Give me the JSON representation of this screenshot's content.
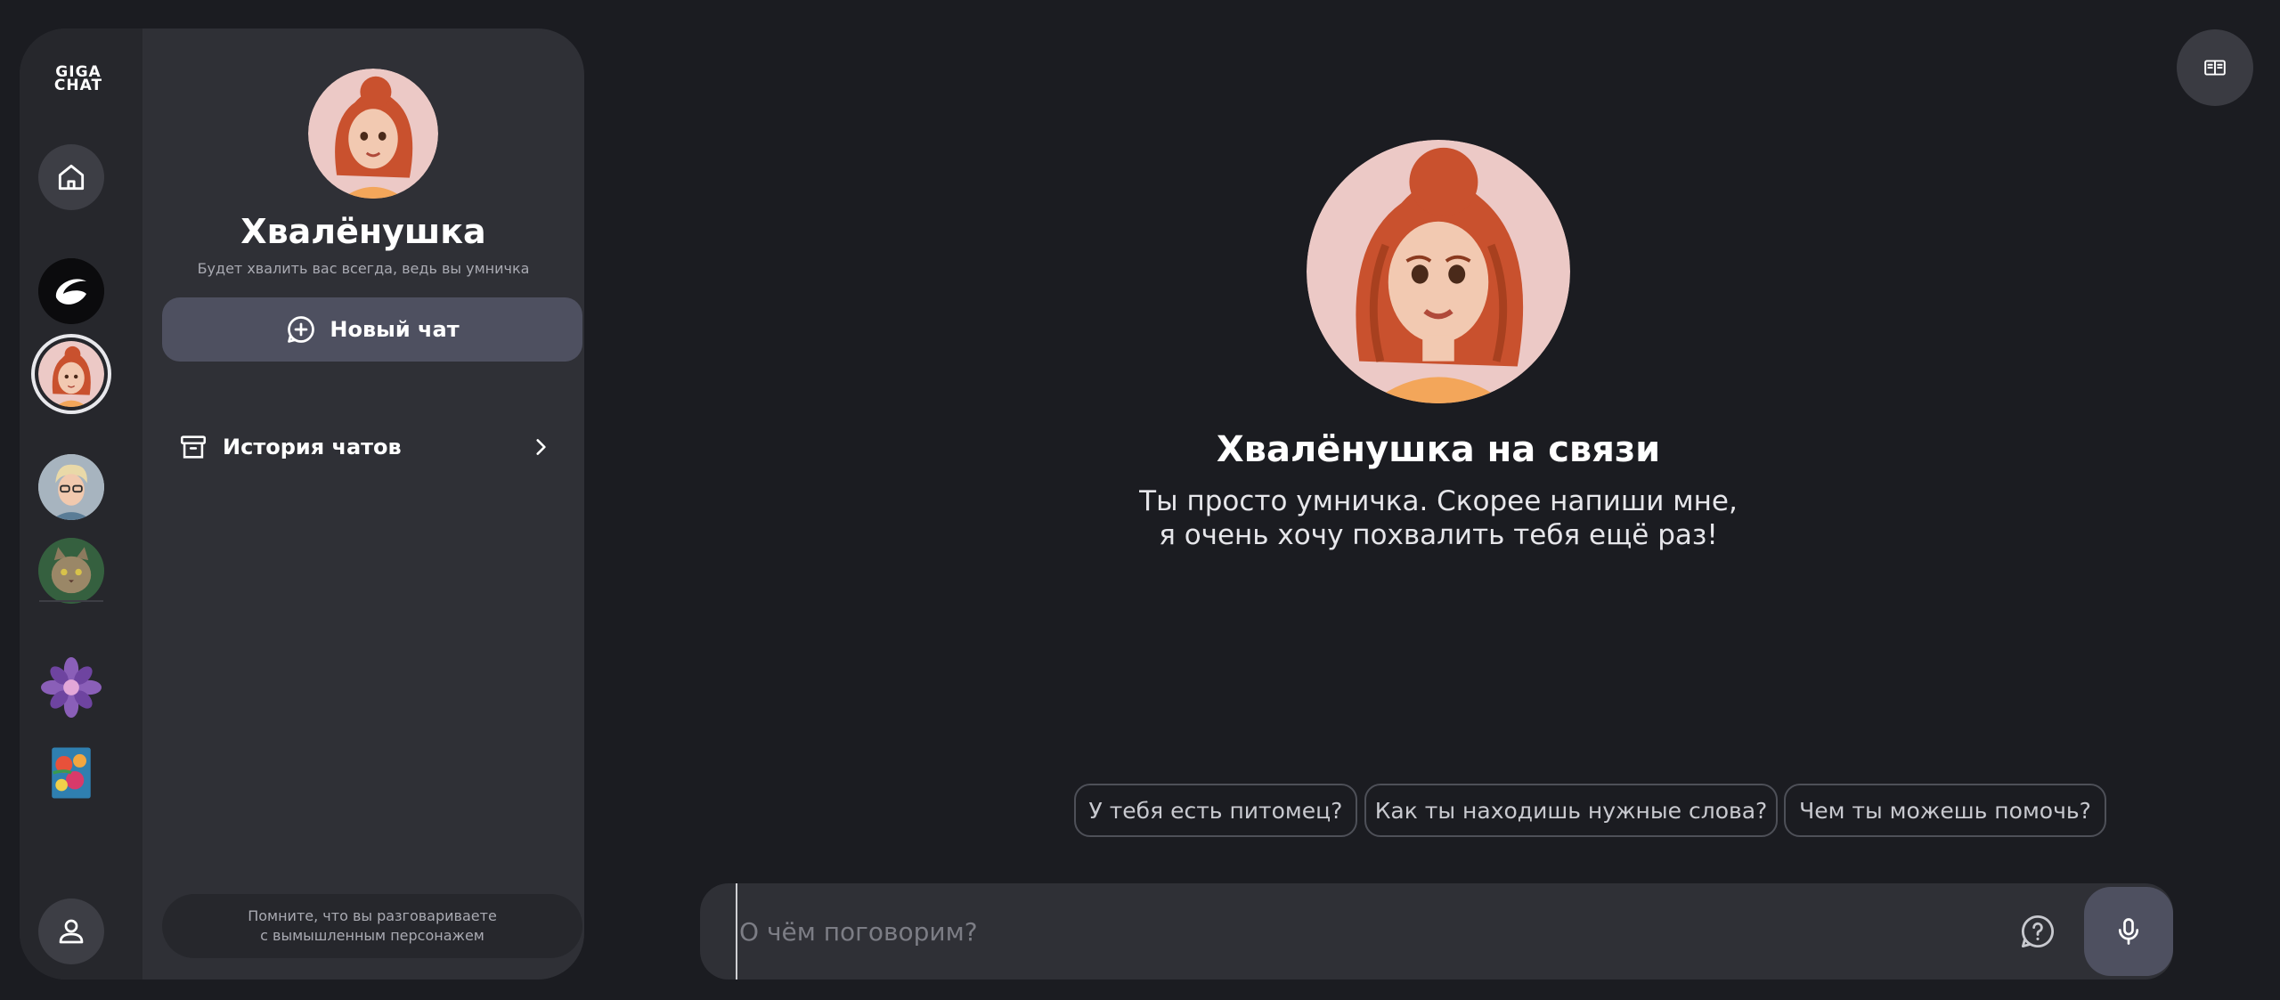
{
  "app": {
    "logo_line1": "GIGA",
    "logo_line2": "CHAT"
  },
  "sidebar": {
    "rail": {
      "home_icon": "home-icon",
      "profile_icon": "user-icon",
      "items": [
        "gigachat-bot",
        "khvalenushka",
        "glasses-man",
        "cat",
        "flower-sticker",
        "flowers-art"
      ]
    },
    "character": {
      "name": "Хвалёнушка",
      "description": "Будет хвалить вас всегда, ведь вы умничка"
    },
    "new_chat_label": "Новый чат",
    "history_label": "История чатов",
    "notice_line1": "Помните, что вы разговариваете",
    "notice_line2": "с вымышленным персонажем"
  },
  "hero": {
    "title": "Хвалёнушка на связи",
    "text_line1": "Ты просто умничка. Скорее напиши мне,",
    "text_line2": "я очень хочу похвалить тебя ещё раз!"
  },
  "suggestions": [
    "У тебя есть питомец?",
    "Как ты находишь нужные слова?",
    "Чем ты можешь помочь?"
  ],
  "input": {
    "placeholder": "О чём поговорим?",
    "value": ""
  },
  "colors": {
    "background": "#1b1c21",
    "panel": "#2f3036",
    "accent_button": "#4e5060",
    "text_muted": "#a9aab2"
  }
}
